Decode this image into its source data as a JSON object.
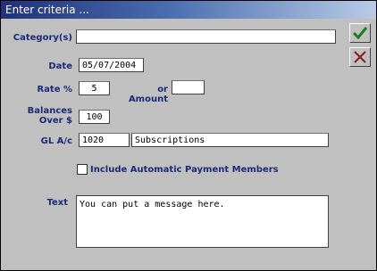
{
  "window": {
    "title": "Enter criteria ..."
  },
  "toolbar": {
    "ok_icon": "check-icon",
    "cancel_icon": "x-icon"
  },
  "form": {
    "category_label": "Category(s)",
    "category_value": "",
    "date_label": "Date",
    "date_value": "05/07/2004",
    "rate_label": "Rate %",
    "rate_value": "5",
    "amount_label": "or Amount",
    "amount_value": "",
    "balances_label_line1": "Balances",
    "balances_label_line2": "Over $",
    "balances_value": "100",
    "gl_label": "GL A/c",
    "gl_code": "1020",
    "gl_name": "Subscriptions",
    "auto_payment_label": "Include Automatic Payment Members",
    "auto_payment_checked": false,
    "text_label": "Text",
    "text_value": "You can put a message here."
  },
  "colors": {
    "label": "#1a2a78",
    "ok_green": "#1f7a1f",
    "cancel_red": "#8a1a1a",
    "title_start": "#20307a",
    "title_end": "#b8cbe6"
  }
}
